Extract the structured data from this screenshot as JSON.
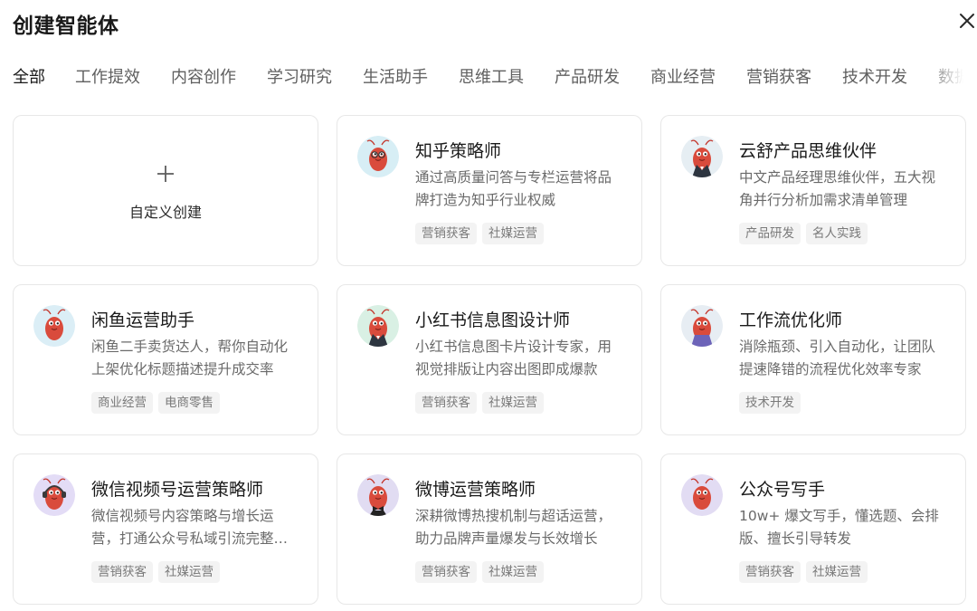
{
  "header": {
    "title": "创建智能体"
  },
  "tabs": [
    {
      "label": "全部",
      "active": true
    },
    {
      "label": "工作提效"
    },
    {
      "label": "内容创作"
    },
    {
      "label": "学习研究"
    },
    {
      "label": "生活助手"
    },
    {
      "label": "思维工具"
    },
    {
      "label": "产品研发"
    },
    {
      "label": "商业经营"
    },
    {
      "label": "营销获客"
    },
    {
      "label": "技术开发"
    },
    {
      "label": "数据分"
    }
  ],
  "create_card": {
    "icon": "plus-icon",
    "label": "自定义创建"
  },
  "agents": [
    {
      "name": "知乎策略师",
      "desc": "通过高质量问答与专栏运营将品牌打造为知乎行业权威",
      "tags": [
        "营销获客",
        "社媒运营"
      ],
      "avatar_bg": "#d7eef5",
      "accessory": "glasses"
    },
    {
      "name": "云舒产品思维伙伴",
      "desc": "中文产品经理思维伙伴，五大视角并行分析加需求清单管理",
      "tags": [
        "产品研发",
        "名人实践"
      ],
      "avatar_bg": "#e6eef3",
      "accessory": "suit"
    },
    {
      "name": "闲鱼运营助手",
      "desc": "闲鱼二手卖货达人，帮你自动化上架优化标题描述提升成交率",
      "tags": [
        "商业经营",
        "电商零售"
      ],
      "avatar_bg": "#dbeef6",
      "accessory": "none"
    },
    {
      "name": "小红书信息图设计师",
      "desc": "小红书信息图卡片设计专家，用视觉排版让内容出图即成爆款",
      "tags": [
        "营销获客",
        "社媒运营"
      ],
      "avatar_bg": "#d9f0e4",
      "accessory": "suit"
    },
    {
      "name": "工作流优化师",
      "desc": "消除瓶颈、引入自动化，让团队提速降错的流程优化效率专家",
      "tags": [
        "技术开发"
      ],
      "avatar_bg": "#e7edf3",
      "accessory": "purple"
    },
    {
      "name": "微信视频号运营策略师",
      "desc": "微信视频号内容策略与增长运营，打通公众号私域引流完整…",
      "tags": [
        "营销获客",
        "社媒运营"
      ],
      "avatar_bg": "#e3dcf6",
      "accessory": "headset"
    },
    {
      "name": "微博运营策略师",
      "desc": "深耕微博热搜机制与超话运营，助力品牌声量爆发与长效增长",
      "tags": [
        "营销获客",
        "社媒运营"
      ],
      "avatar_bg": "#e1dcf2",
      "accessory": "bowtie"
    },
    {
      "name": "公众号写手",
      "desc": "10w+ 爆文写手，懂选题、会排版、擅长引导转发",
      "tags": [
        "营销获客",
        "社媒运营"
      ],
      "avatar_bg": "#e2dcf3",
      "accessory": "none"
    }
  ]
}
